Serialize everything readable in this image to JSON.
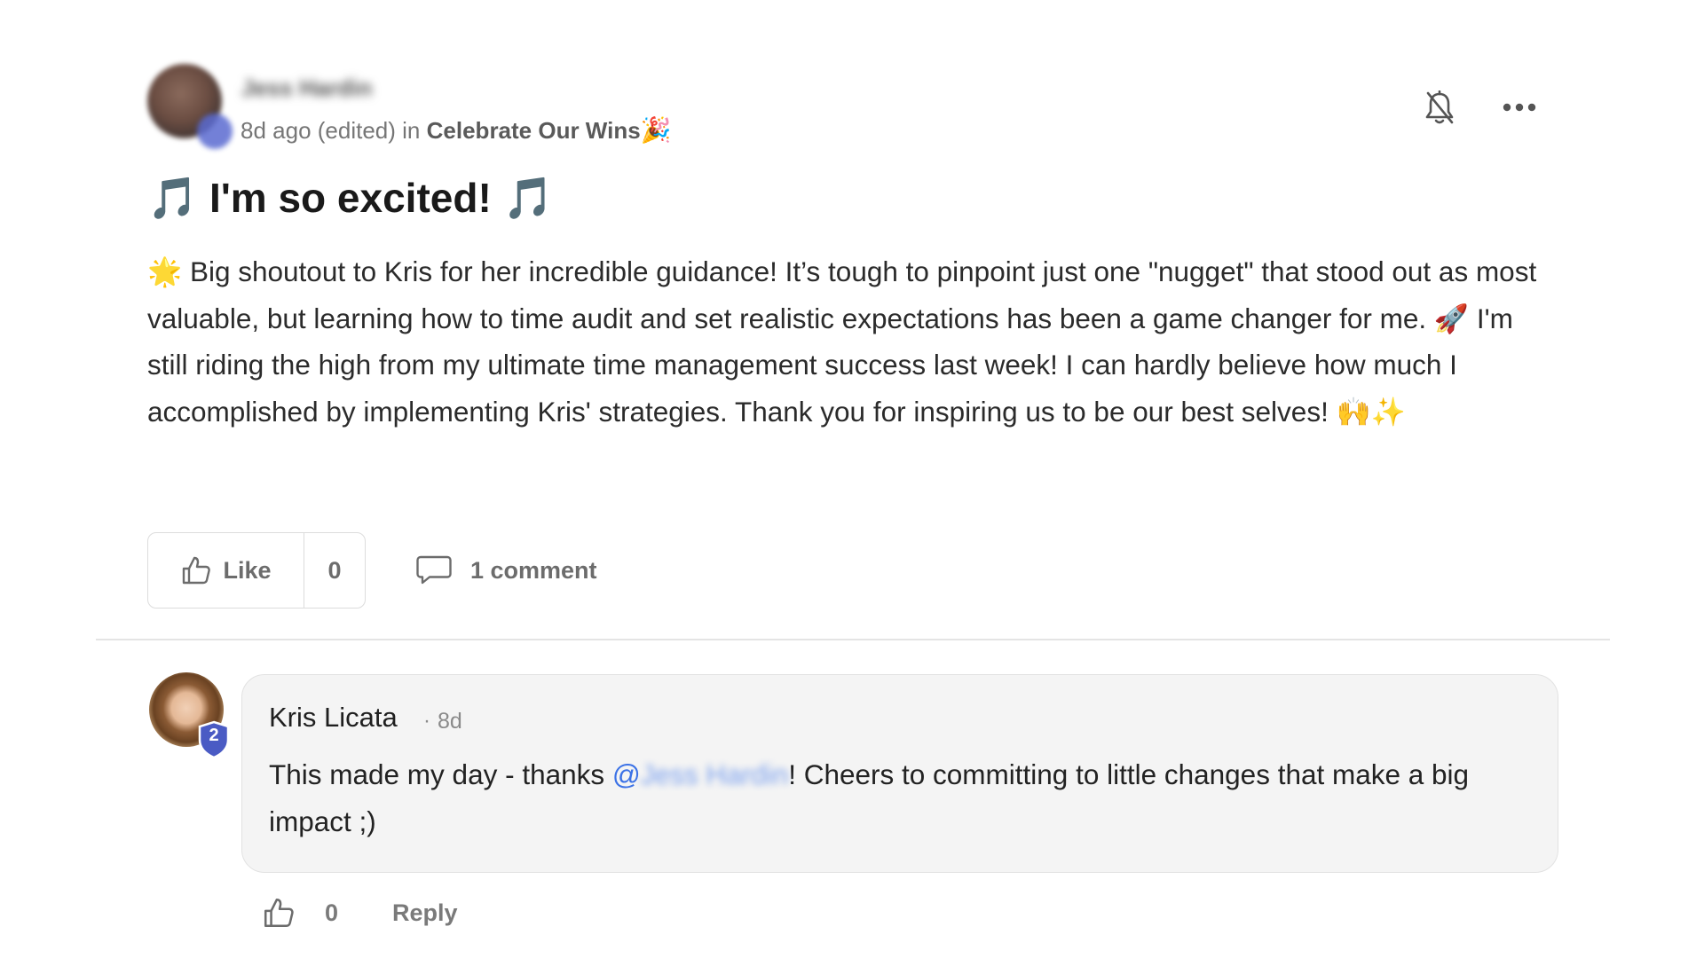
{
  "post": {
    "author_name": "Jess Hardin",
    "time_ago": "8d ago",
    "edited": "(edited)",
    "in_word": "in",
    "space_name": "Celebrate Our Wins",
    "space_emoji": "🎉",
    "title": "🎵 I'm so excited! 🎵",
    "body": "🌟 Big shoutout to Kris for her incredible guidance! It’s tough to pinpoint just one \"nugget\" that stood out as most valuable, but learning how to time audit and set realistic expectations has been a game changer for me. 🚀 I'm still riding the high from my ultimate time management success last week! I can hardly believe how much I accomplished by implementing Kris' strategies. Thank you for inspiring us to be our best selves! 🙌✨",
    "like_label": "Like",
    "like_count": "0",
    "comment_label": "1 comment",
    "icons": {
      "notification": "bell-off-icon",
      "more": "more-horizontal-icon",
      "like": "thumbs-up-icon",
      "comment": "speech-bubble-icon"
    }
  },
  "comment": {
    "author_name": "Kris Licata",
    "separator": "·",
    "time": "8d",
    "badge_level": "2",
    "text_before": "This made my day - thanks ",
    "mention_at": "@",
    "mention_name": "Jess Hardin",
    "text_after": "! Cheers to committing to little changes that make a big impact ;)",
    "like_count": "0",
    "reply_label": "Reply"
  },
  "colors": {
    "badge": "#4a5bc4",
    "mention": "#3c72e6",
    "muted_text": "#6c6c6c",
    "border": "#dcdcdc",
    "bubble_bg": "#f4f4f4"
  }
}
